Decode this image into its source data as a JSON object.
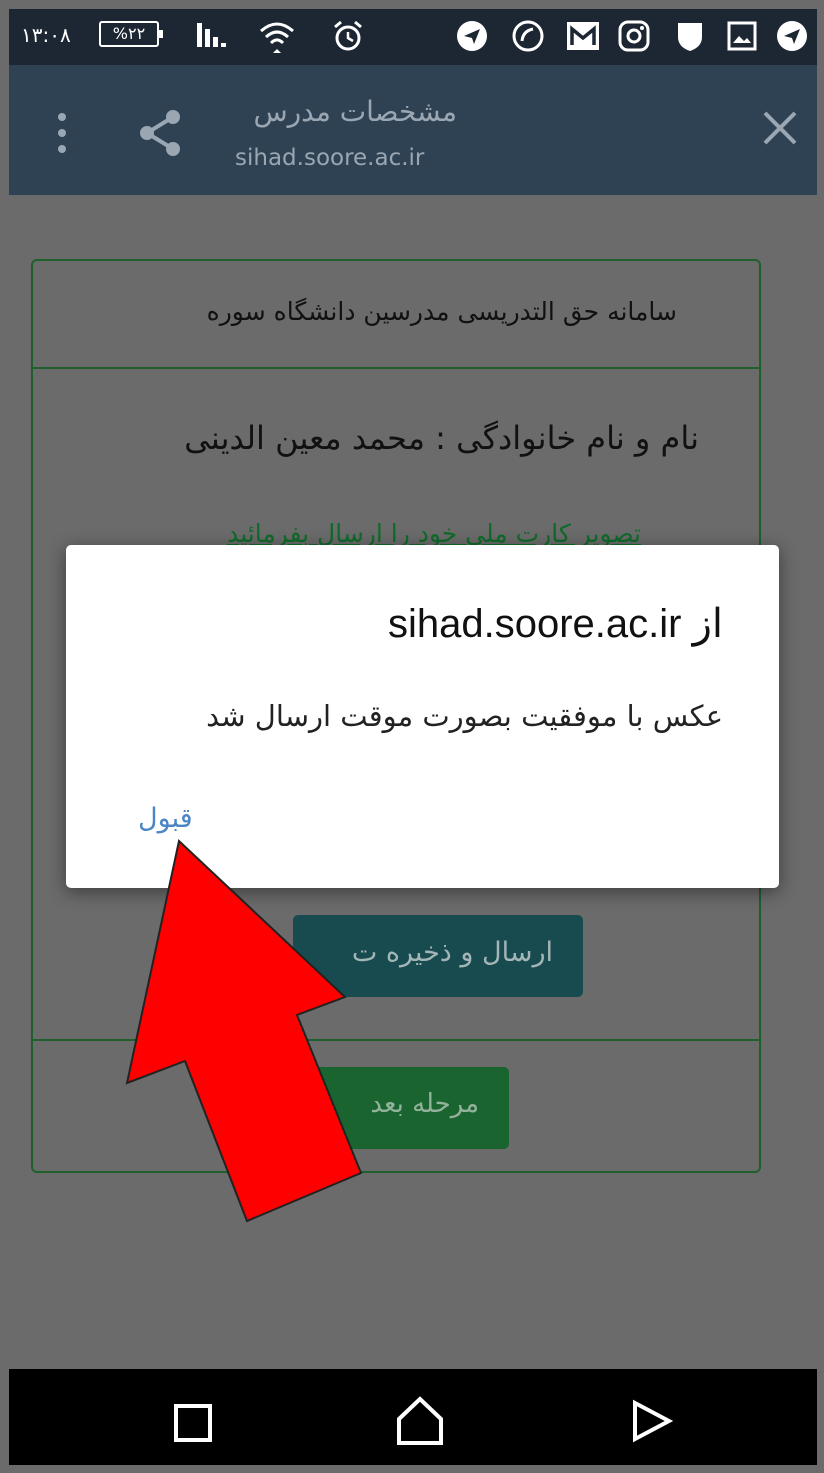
{
  "status_bar": {
    "time": "۱۳:۰۸",
    "battery": "%۲۲",
    "icons": [
      "signal-icon",
      "wifi-icon",
      "alarm-icon",
      "telegram-icon",
      "phone-icon",
      "gmail-icon",
      "instagram-icon",
      "shield-icon",
      "gallery-icon",
      "telegram-icon"
    ]
  },
  "app_bar": {
    "title": "مشخصات مدرس",
    "url": "sihad.soore.ac.ir",
    "icons": [
      "close-icon",
      "share-icon",
      "more-vert-icon"
    ]
  },
  "page": {
    "header": "سامانه حق التدریسی مدرسین دانشگاه سوره",
    "name_line": "نام و نام خانوادگی : محمد معین الدینی",
    "upload_hint": "تصویر کارت ملی خود را ارسال بفرمائید",
    "send_button": "ارسال و ذخیره ت",
    "next_button": "مرحله بعد"
  },
  "dialog": {
    "title": "از sihad.soore.ac.ir",
    "message": "عکس با موفقیت بصورت موقت ارسال شد",
    "ok_label": "قبول"
  },
  "annotation": {
    "arrow_color": "#ff0000"
  },
  "nav_bar": {
    "icons": [
      "recents-icon",
      "home-icon",
      "back-icon"
    ]
  },
  "colors": {
    "status_bar": "#1c2733",
    "app_bar": "#2f4254",
    "scrim": "#6b6b6b",
    "card_border": "#1f5f2c",
    "link_blue": "#4a86c5"
  }
}
